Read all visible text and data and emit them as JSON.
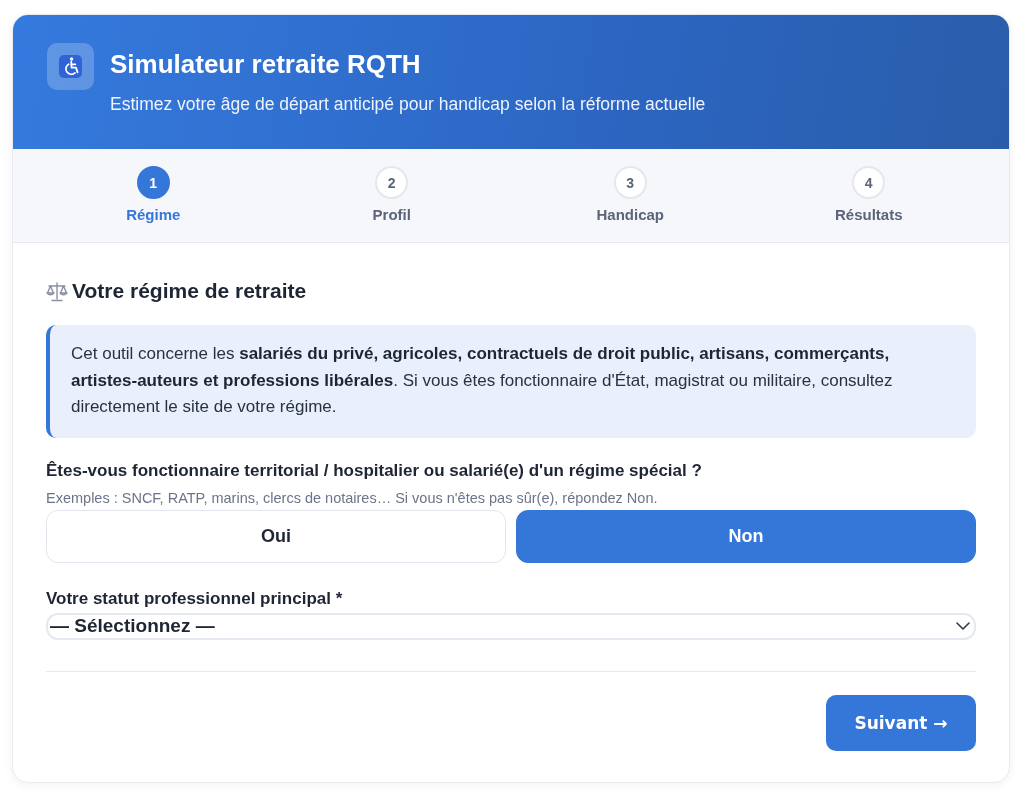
{
  "header": {
    "title": "Simulateur retraite RQTH",
    "subtitle": "Estimez votre âge de départ anticipé pour handicap selon la réforme actuelle"
  },
  "steps": [
    {
      "number": "1",
      "label": "Régime",
      "selected": true
    },
    {
      "number": "2",
      "label": "Profil",
      "selected": false
    },
    {
      "number": "3",
      "label": "Handicap",
      "selected": false
    },
    {
      "number": "4",
      "label": "Résultats",
      "selected": false
    }
  ],
  "section": {
    "title": "Votre régime de retraite"
  },
  "notice": {
    "text": "Cet outil concerne les **salariés du privé, agricoles, contractuels de droit public, artisans, commerçants, artistes-auteurs et professions libérales**. Si vous êtes fonctionnaire d'État, magistrat ou militaire, consultez directement le site de votre régime."
  },
  "question": {
    "label": "Êtes-vous fonctionnaire territorial / hospitalier ou salarié(e) d'un régime spécial ?",
    "hint": "Exemples : SNCF, RATP, marins, clercs de notaires… Si vous n'êtes pas sûr(e), répondez Non.",
    "options": [
      {
        "label": "Oui",
        "selected": false
      },
      {
        "label": "Non",
        "selected": true
      }
    ]
  },
  "status_select": {
    "label": "Votre statut professionnel principal *",
    "value": "— Sélectionnez —"
  },
  "next_button": {
    "label": "Suivant →"
  }
}
